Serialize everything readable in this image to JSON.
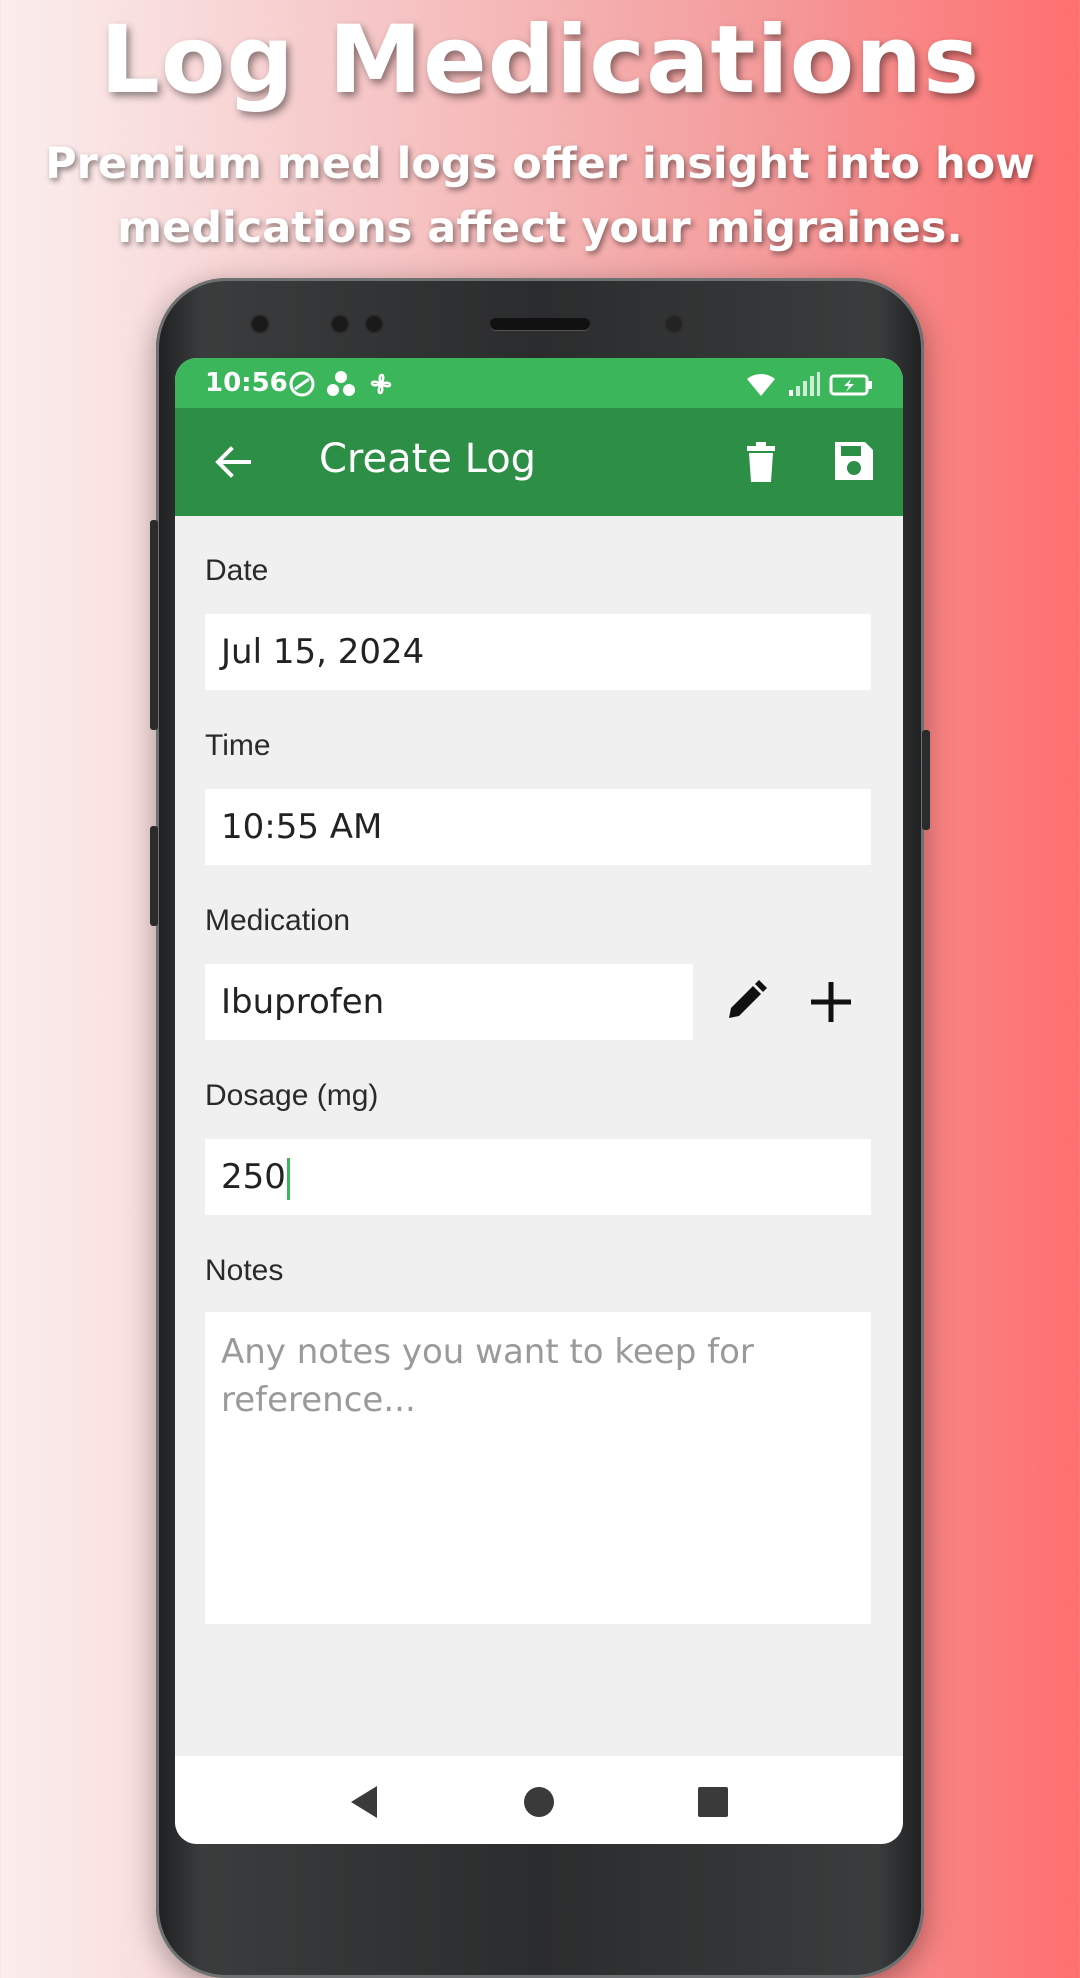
{
  "promo": {
    "title": "Log Medications",
    "subtitle": "Premium med logs offer insight into how medications affect your migraines."
  },
  "status_bar": {
    "time": "10:56",
    "left_icons": [
      "notification-icon",
      "app-icon",
      "fan-icon"
    ],
    "right_icons": [
      "wifi-icon",
      "signal-icon",
      "battery-charging-icon"
    ]
  },
  "app_bar": {
    "title": "Create Log",
    "back_icon": "arrow-left-icon",
    "actions": [
      "trash-icon",
      "save-icon"
    ]
  },
  "form": {
    "date": {
      "label": "Date",
      "value": "Jul 15, 2024"
    },
    "time": {
      "label": "Time",
      "value": "10:55 AM"
    },
    "medication": {
      "label": "Medication",
      "value": "Ibuprofen",
      "icons": [
        "pencil-icon",
        "plus-icon"
      ]
    },
    "dosage": {
      "label": "Dosage (mg)",
      "value": "250"
    },
    "notes": {
      "label": "Notes",
      "placeholder": "Any notes you want to keep for reference..."
    }
  },
  "nav_bar": {
    "icons": [
      "nav-back-icon",
      "nav-home-icon",
      "nav-recents-icon"
    ]
  },
  "colors": {
    "status_bar": "#3cb65a",
    "app_bar": "#2d8e46",
    "accent": "#3cb65a",
    "background": "#f0f0f0"
  }
}
